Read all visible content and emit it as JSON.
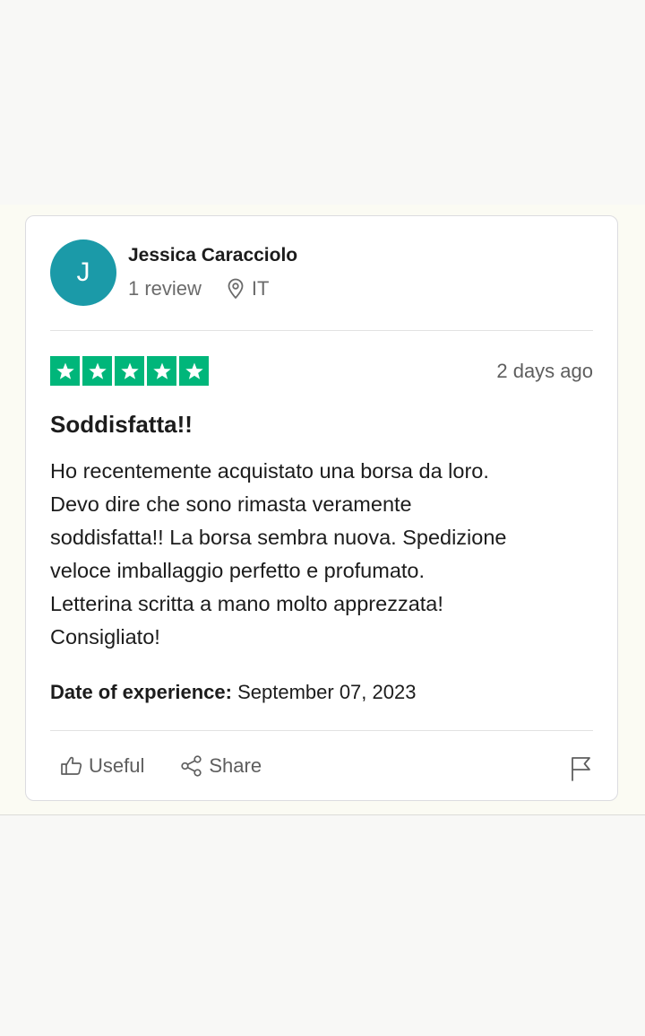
{
  "review": {
    "reviewer": {
      "initial": "J",
      "name": "Jessica Caracciolo",
      "review_count": "1 review",
      "country": "IT",
      "avatar_color": "#1b9aa8"
    },
    "rating": {
      "stars": 5,
      "max": 5,
      "color": "#00b67a"
    },
    "posted": "2 days ago",
    "title": "Soddisfatta!!",
    "body_lines": [
      "Ho recentemente acquistato una borsa da loro.",
      "Devo dire che sono rimasta veramente",
      "soddisfatta!! La borsa sembra nuova. Spedizione",
      "veloce imballaggio perfetto e profumato.",
      "Letterina scritta a mano molto apprezzata!",
      "Consigliato!"
    ],
    "experience_label": "Date of experience:",
    "experience_date": "September 07, 2023"
  },
  "actions": {
    "useful_label": "Useful",
    "share_label": "Share",
    "useful_icon": "thumbs-up-icon",
    "share_icon": "share-icon",
    "report_icon": "flag-icon"
  }
}
